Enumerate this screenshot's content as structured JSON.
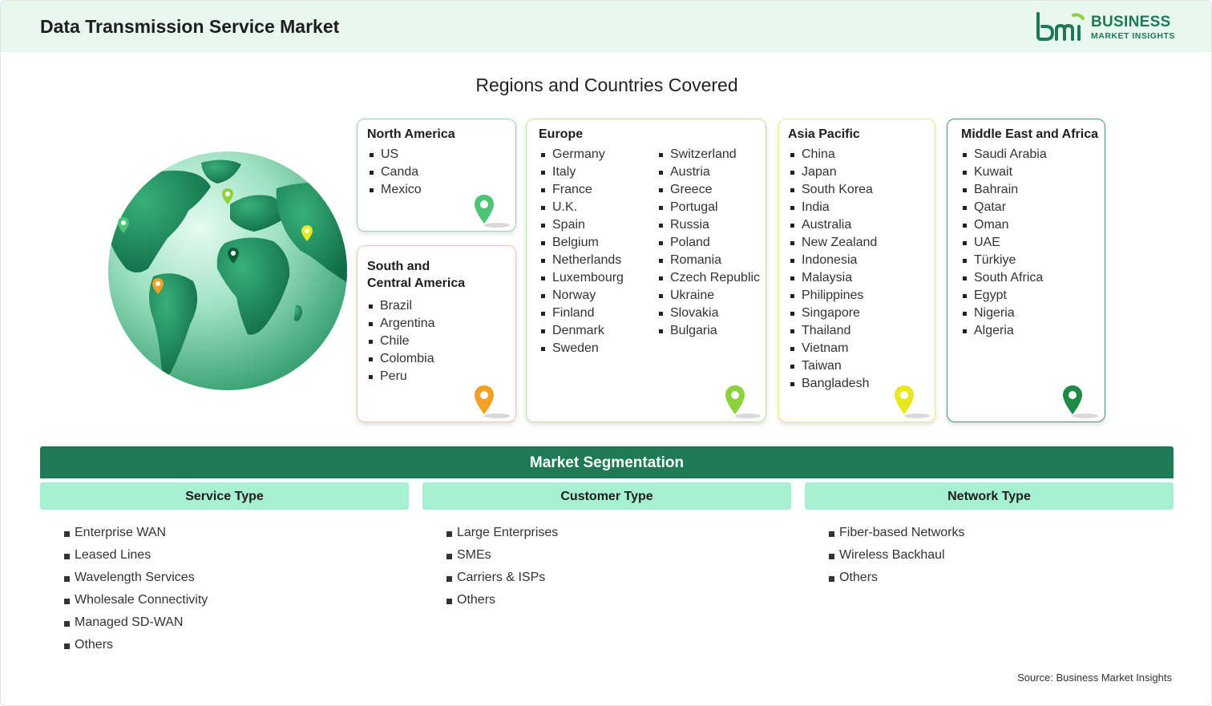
{
  "header": {
    "title": "Data Transmission Service Market",
    "logo_line1": "BUSINESS",
    "logo_line2": "MARKET INSIGHTS",
    "brand_color": "#1e7a55"
  },
  "regions": {
    "title": "Regions and Countries Covered",
    "north_america": {
      "title": "North America",
      "items": [
        "US",
        "Canda",
        "Mexico"
      ],
      "pin_color": "#4cc476"
    },
    "south_central_america": {
      "title_line1": "South and",
      "title_line2": "Central America",
      "items": [
        "Brazil",
        "Argentina",
        "Chile",
        "Colombia",
        "Peru"
      ],
      "pin_color": "#f4a024"
    },
    "europe": {
      "title": "Europe",
      "col1": [
        "Germany",
        "Italy",
        "France",
        "U.K.",
        "Spain",
        "Belgium",
        "Netherlands",
        "Luxembourg",
        "Norway",
        "Finland",
        "Denmark",
        "Sweden"
      ],
      "col2": [
        "Switzerland",
        "Austria",
        "Greece",
        "Portugal",
        "Russia",
        "Poland",
        "Romania",
        "Czech Republic",
        "Ukraine",
        "Slovakia",
        "Bulgaria"
      ],
      "pin_color": "#8cd23c"
    },
    "asia_pacific": {
      "title": "Asia Pacific",
      "items": [
        "China",
        "Japan",
        "South Korea",
        "India",
        "Australia",
        "New Zealand",
        "Indonesia",
        "Malaysia",
        "Philippines",
        "Singapore",
        "Thailand",
        "Vietnam",
        "Taiwan",
        "Bangladesh"
      ],
      "pin_color": "#e8e81e"
    },
    "middle_east_africa": {
      "title": "Middle East and Africa",
      "items": [
        "Saudi Arabia",
        "Kuwait",
        "Bahrain",
        "Qatar",
        "Oman",
        "UAE",
        "Türkiye",
        "South Africa",
        "Egypt",
        "Nigeria",
        "Algeria"
      ],
      "pin_color": "#1e8a46"
    }
  },
  "segmentation": {
    "title": "Market Segmentation",
    "service_type": {
      "title": "Service Type",
      "items": [
        "Enterprise WAN",
        "Leased Lines",
        "Wavelength Services",
        "Wholesale Connectivity",
        "Managed SD-WAN",
        "Others"
      ]
    },
    "customer_type": {
      "title": "Customer Type",
      "items": [
        "Large Enterprises",
        "SMEs",
        "Carriers & ISPs",
        "Others"
      ]
    },
    "network_type": {
      "title": "Network Type",
      "items": [
        "Fiber-based Networks",
        "Wireless Backhaul",
        "Others"
      ]
    }
  },
  "source": "Source: Business Market Insights"
}
